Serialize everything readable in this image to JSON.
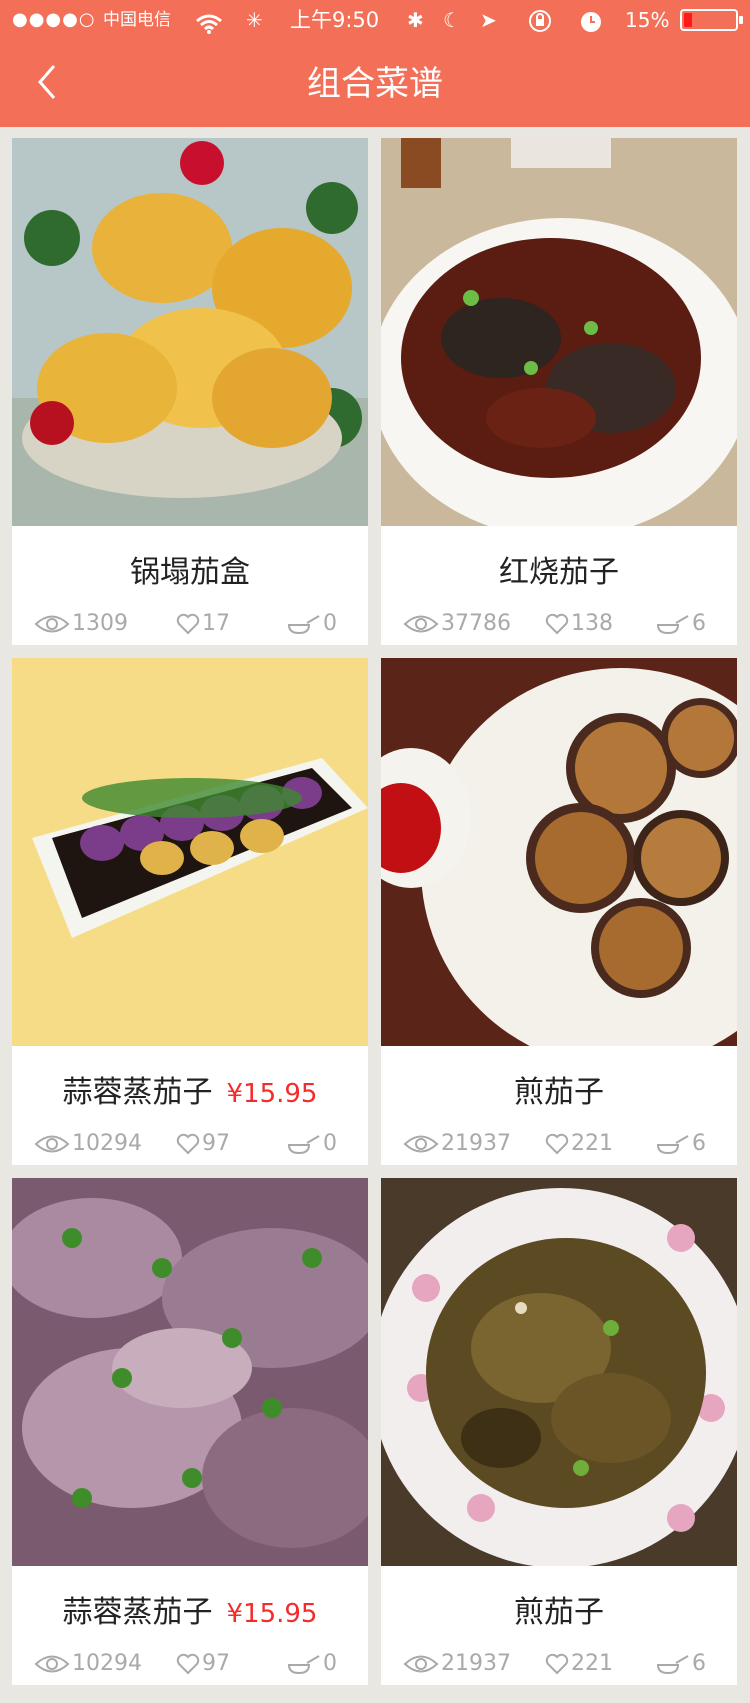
{
  "status_bar": {
    "signal": "●●●●○",
    "carrier": "中国电信",
    "time": "上午9:50",
    "battery_percent": "15%",
    "battery_level": 0.15
  },
  "nav": {
    "title": "组合菜谱",
    "back_icon": "chevron-left-icon"
  },
  "colors": {
    "accent": "#f46f57",
    "price": "#f32b2b",
    "background": "#e9e7e2"
  },
  "recipes": [
    {
      "name": "锅塌茄盒",
      "price": "",
      "views": "1309",
      "likes": "17",
      "cooks": "0"
    },
    {
      "name": "红烧茄子",
      "price": "",
      "views": "37786",
      "likes": "138",
      "cooks": "6"
    },
    {
      "name": "蒜蓉蒸茄子",
      "price": "¥15.95",
      "views": "10294",
      "likes": "97",
      "cooks": "0"
    },
    {
      "name": "煎茄子",
      "price": "",
      "views": "21937",
      "likes": "221",
      "cooks": "6"
    },
    {
      "name": "蒜蓉蒸茄子",
      "price": "¥15.95",
      "views": "10294",
      "likes": "97",
      "cooks": "0"
    },
    {
      "name": "煎茄子",
      "price": "",
      "views": "21937",
      "likes": "221",
      "cooks": "6"
    }
  ]
}
